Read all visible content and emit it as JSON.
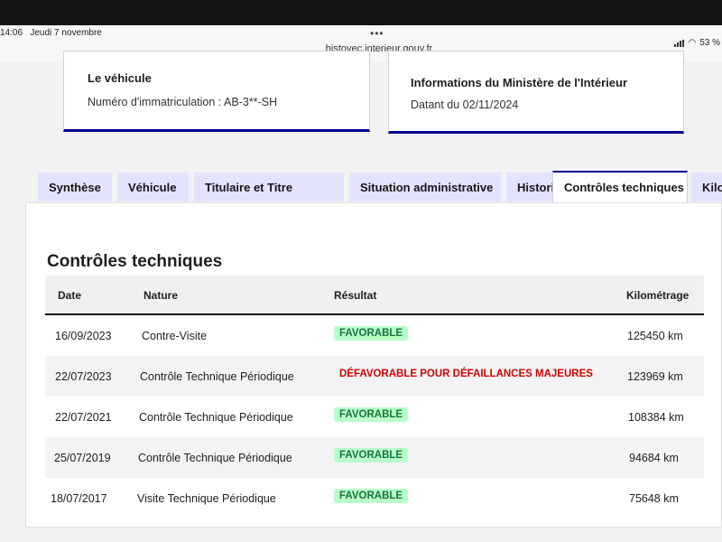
{
  "status": {
    "time": "14:06",
    "date": "Jeudi 7 novembre",
    "url": "histovec.interieur.gouv.fr",
    "battery": "53 %"
  },
  "vehicle_card": {
    "title": "Le véhicule",
    "plate_text": "Numéro d'immatriculation : AB-3**-SH"
  },
  "ministry_card": {
    "title": "Informations du Ministère de l'Intérieur",
    "date_text": "Datant du 02/11/2024"
  },
  "tabs": [
    {
      "label": "Synthèse"
    },
    {
      "label": "Véhicule"
    },
    {
      "label": "Titulaire et Titre"
    },
    {
      "label": "Situation administrative"
    },
    {
      "label": "Historique"
    },
    {
      "label": "Contrôles techniques"
    },
    {
      "label": "Kilo"
    }
  ],
  "section_title": "Contrôles techniques",
  "table": {
    "headers": {
      "date": "Date",
      "nature": "Nature",
      "result": "Résultat",
      "km": "Kilométrage"
    },
    "rows": [
      {
        "date": "16/09/2023",
        "nature": "Contre-Visite",
        "result": "FAVORABLE",
        "km": "125450 km"
      },
      {
        "date": "22/07/2023",
        "nature": "Contrôle Technique Périodique",
        "result": "DÉFAVORABLE POUR DÉFAILLANCES MAJEURES",
        "km": "123969 km"
      },
      {
        "date": "22/07/2021",
        "nature": "Contrôle Technique Périodique",
        "result": "FAVORABLE",
        "km": "108384 km"
      },
      {
        "date": "25/07/2019",
        "nature": "Contrôle Technique Périodique",
        "result": "FAVORABLE",
        "km": "94684 km"
      },
      {
        "date": "18/07/2017",
        "nature": "Visite Technique Périodique",
        "result": "FAVORABLE",
        "km": "75648 km"
      }
    ]
  },
  "colors": {
    "accent": "#000091",
    "favorable": "#18753c",
    "defavorable": "#ce0500"
  }
}
